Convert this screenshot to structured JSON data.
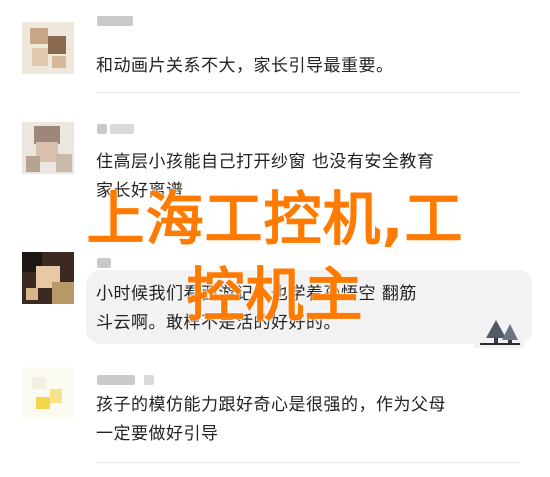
{
  "comments": [
    {
      "text_line1": "和动画片关系不大，家长引导最重要。",
      "text_line2": ""
    },
    {
      "text_line1": "住高层小孩能自己打开纱窗 也没有安全教育",
      "text_line2": "家长好离谱"
    },
    {
      "text_line1": "小时候我们看西游记，也学着孙悟空  翻筋",
      "text_line2": "斗云啊。敢样不是活的好好的。"
    },
    {
      "text_line1": "孩子的模仿能力跟好奇心是很强的，作为父母",
      "text_line2": "一定要做好引导"
    }
  ],
  "watermark": {
    "line1": "上海工控机,工",
    "line2": "控机主"
  },
  "colors": {
    "watermark": "#ff7a00",
    "bubble": "#f2f2f2",
    "text": "#222222"
  },
  "icons": {
    "sticker": "tree-sticker-icon"
  }
}
